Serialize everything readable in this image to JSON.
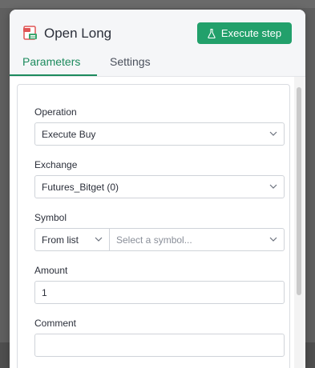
{
  "modal": {
    "title": "Open Long",
    "execute_button_label": "Execute step",
    "app_icon": "report-icon"
  },
  "tabs": [
    {
      "label": "Parameters",
      "active": true
    },
    {
      "label": "Settings",
      "active": false
    }
  ],
  "form": {
    "operation": {
      "label": "Operation",
      "value": "Execute Buy"
    },
    "exchange": {
      "label": "Exchange",
      "value": "Futures_Bitget (0)"
    },
    "symbol": {
      "label": "Symbol",
      "mode": "From list",
      "placeholder": "Select a symbol..."
    },
    "amount": {
      "label": "Amount",
      "value": "1"
    },
    "comment": {
      "label": "Comment",
      "value": ""
    }
  },
  "colors": {
    "accent": "#22a06b",
    "tab_active": "#1c8a5d"
  }
}
